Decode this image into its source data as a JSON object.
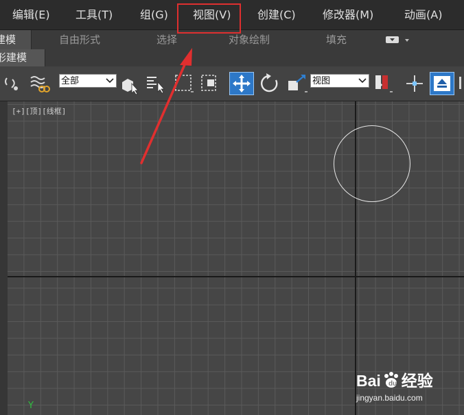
{
  "menu": {
    "items": [
      "编辑(E)",
      "工具(T)",
      "组(G)",
      "视图(V)",
      "创建(C)",
      "修改器(M)",
      "动画(A)"
    ]
  },
  "ribbon": {
    "active_tab": "建模",
    "tabs": [
      "自由形式",
      "选择",
      "对象绘制",
      "填充"
    ]
  },
  "subribbon": {
    "label": "形建模"
  },
  "toolbar": {
    "filter_value": "全部",
    "coord_system_value": "视图"
  },
  "viewport": {
    "label": "[+][顶][线框]",
    "axis_label": "Y"
  },
  "annotation": {
    "color": "#e02f2f"
  },
  "watermark": {
    "brand": "Bai",
    "brand_rest": "经验",
    "url": "jingyan.baidu.com"
  }
}
